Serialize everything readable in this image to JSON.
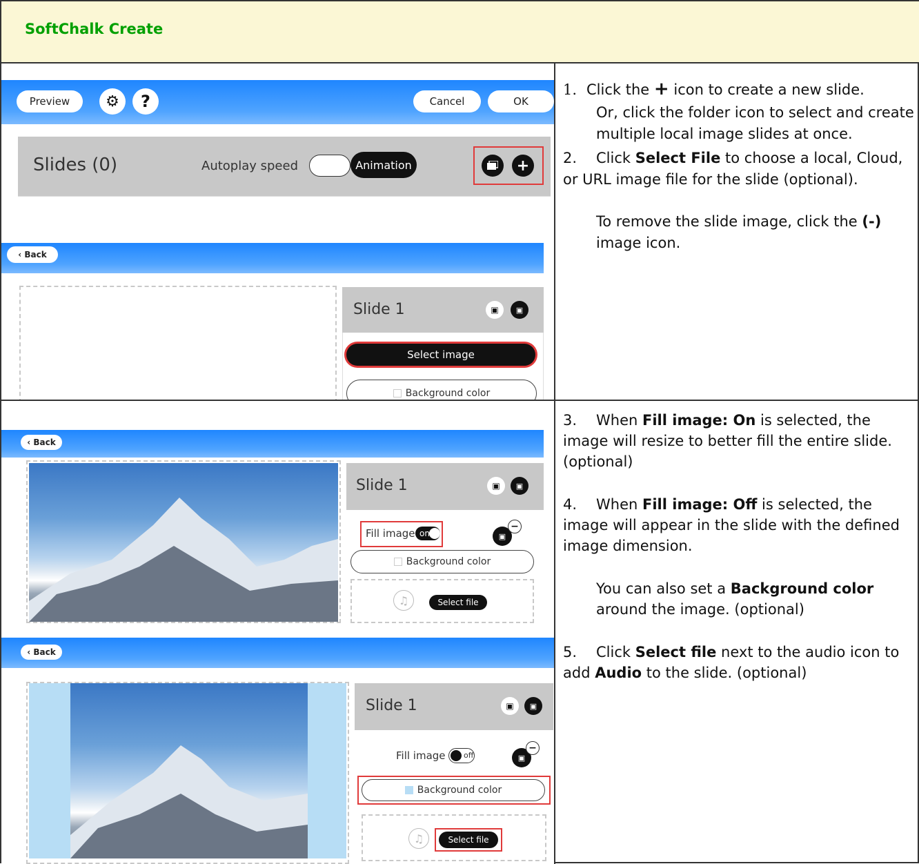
{
  "header": {
    "title": "SoftChalk Create"
  },
  "toolbar": {
    "preview": "Preview",
    "gear": "⚙",
    "help": "?",
    "cancel": "Cancel",
    "ok": "OK"
  },
  "slides_panel": {
    "title": "Slides (0)",
    "autoplay": "Autoplay speed",
    "animation": "Animation",
    "plus": "+"
  },
  "editor": {
    "back": "‹ Back",
    "slide_title": "Slide 1",
    "select_image": "Select image",
    "bg_color": "Background color",
    "fill_on_label": "Fill image",
    "fill_on": "on",
    "fill_off_label": "Fill image",
    "fill_off": "off",
    "select_file": "Select file"
  },
  "instructions_top": {
    "s1_num": "1.",
    "s1_a": "Click the",
    "s1_plus": "+",
    "s1_b": "icon to create a new slide.",
    "s1_c": "Or, click the folder icon to select and create multiple local image slides at once.",
    "s2_num": "2.",
    "s2_a": "Click",
    "s2_bold": "Select File",
    "s2_b": "to choose a local, Cloud, or URL image file for the slide (optional).",
    "s2_c": "To remove the slide image, click the",
    "s2_bold2": "(-)",
    "s2_d": "image icon."
  },
  "instructions_bottom": {
    "s3_num": "3.",
    "s3_a": "When",
    "s3_bold": "Fill image: On",
    "s3_b": "is selected, the image will resize to better fill the entire slide. (optional)",
    "s4_num": "4.",
    "s4_a": "When",
    "s4_bold": "Fill image: Off",
    "s4_b": "is selected, the image will appear in the slide with the defined image dimension.",
    "s4_c": "You can also set a",
    "s4_bold2": "Background color",
    "s4_d": "around the image. (optional)",
    "s5_num": "5.",
    "s5_a": "Click",
    "s5_bold": "Select file",
    "s5_b": "next to the audio icon to add",
    "s5_bold2": "Audio",
    "s5_c": "to the slide. (optional)"
  }
}
